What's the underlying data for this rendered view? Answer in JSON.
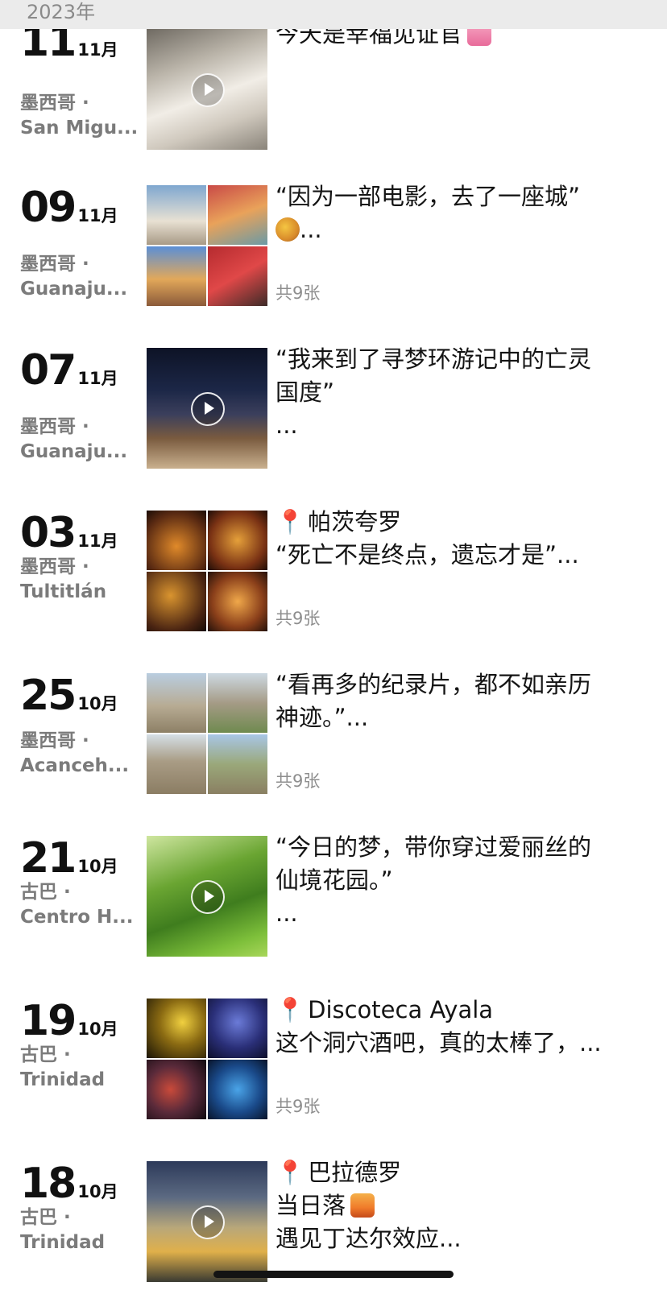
{
  "header": {
    "year": "2023年"
  },
  "entries": [
    {
      "day": "11",
      "month": "11月",
      "loc1": "墨西哥 ·",
      "loc2": "San Migu...",
      "lines": [
        "今天是幸福见证官"
      ],
      "emoji": "wedding-chapel",
      "count": "",
      "media": "video"
    },
    {
      "day": "09",
      "month": "11月",
      "loc1": "墨西哥 ·",
      "loc2": "Guanaju...",
      "lines": [
        "“因为一部电影，去了一座城”",
        "..."
      ],
      "emoji": "artist-palette",
      "count": "共9张",
      "media": "grid"
    },
    {
      "day": "07",
      "month": "11月",
      "loc1": "墨西哥 ·",
      "loc2": "Guanaju...",
      "lines": [
        "“我来到了寻梦环游记中的亡灵",
        "国度”",
        "..."
      ],
      "count": "",
      "media": "video"
    },
    {
      "day": "03",
      "month": "11月",
      "loc1": "墨西哥 ·",
      "loc2": "Tultitlán",
      "pin": "帕茨夸罗",
      "lines": [
        "“死亡不是终点，遗忘才是”..."
      ],
      "count": "共9张",
      "media": "grid"
    },
    {
      "day": "25",
      "month": "10月",
      "loc1": "墨西哥 ·",
      "loc2": "Acanceh...",
      "lines": [
        "“看再多的纪录片，都不如亲历",
        "神迹。”..."
      ],
      "count": "共9张",
      "media": "grid"
    },
    {
      "day": "21",
      "month": "10月",
      "loc1": "古巴 ·",
      "loc2": "Centro H...",
      "lines": [
        "“今日的梦，带你穿过爱丽丝的",
        "仙境花园。”",
        "..."
      ],
      "count": "",
      "media": "video"
    },
    {
      "day": "19",
      "month": "10月",
      "loc1": "古巴 ·",
      "loc2": "Trinidad",
      "pin": "Discoteca Ayala",
      "lines": [
        "这个洞穴酒吧，真的太棒了，..."
      ],
      "count": "共9张",
      "media": "grid"
    },
    {
      "day": "18",
      "month": "10月",
      "loc1": "古巴 ·",
      "loc2": "Trinidad",
      "pin": "巴拉德罗",
      "lines": [
        "当日落",
        "遇见丁达尔效应..."
      ],
      "emoji": "sunset",
      "count": "",
      "media": "video"
    }
  ]
}
